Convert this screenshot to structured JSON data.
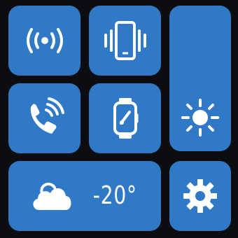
{
  "theme": {
    "accent": "#2f79c6",
    "background": "#0b0d10",
    "icon_color": "#ffffff"
  },
  "tiles": [
    {
      "id": "broadcast",
      "icon": "broadcast-icon"
    },
    {
      "id": "vibrate",
      "icon": "phone-vibrate-icon"
    },
    {
      "id": "brightness",
      "icon": "sun-icon"
    },
    {
      "id": "call",
      "icon": "phone-call-icon"
    },
    {
      "id": "watch",
      "icon": "smartwatch-icon"
    },
    {
      "id": "weather",
      "icon": "cloud-icon",
      "temperature": "-20°"
    },
    {
      "id": "settings",
      "icon": "gear-icon"
    }
  ]
}
